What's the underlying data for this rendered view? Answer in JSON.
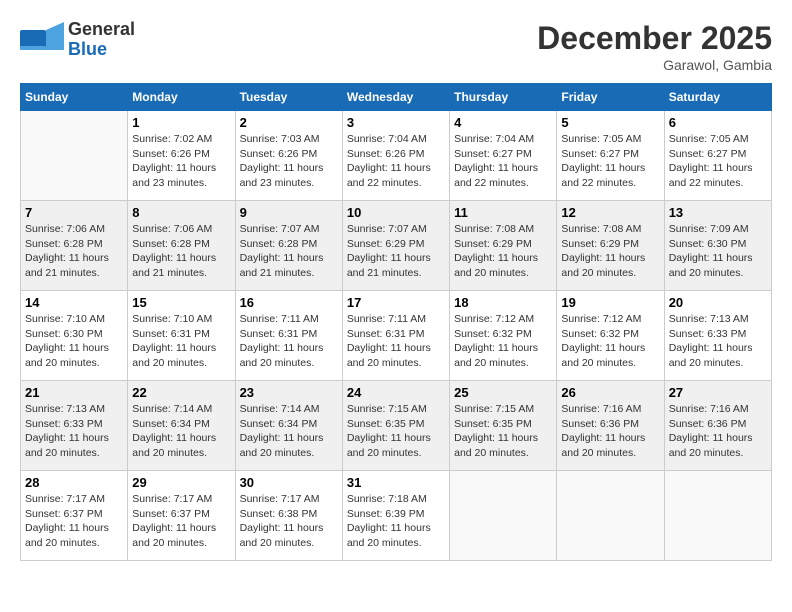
{
  "logo": {
    "line1": "General",
    "line2": "Blue"
  },
  "title": "December 2025",
  "subtitle": "Garawol, Gambia",
  "days_of_week": [
    "Sunday",
    "Monday",
    "Tuesday",
    "Wednesday",
    "Thursday",
    "Friday",
    "Saturday"
  ],
  "weeks": [
    [
      {
        "day": "",
        "info": ""
      },
      {
        "day": "1",
        "info": "Sunrise: 7:02 AM\nSunset: 6:26 PM\nDaylight: 11 hours\nand 23 minutes."
      },
      {
        "day": "2",
        "info": "Sunrise: 7:03 AM\nSunset: 6:26 PM\nDaylight: 11 hours\nand 23 minutes."
      },
      {
        "day": "3",
        "info": "Sunrise: 7:04 AM\nSunset: 6:26 PM\nDaylight: 11 hours\nand 22 minutes."
      },
      {
        "day": "4",
        "info": "Sunrise: 7:04 AM\nSunset: 6:27 PM\nDaylight: 11 hours\nand 22 minutes."
      },
      {
        "day": "5",
        "info": "Sunrise: 7:05 AM\nSunset: 6:27 PM\nDaylight: 11 hours\nand 22 minutes."
      },
      {
        "day": "6",
        "info": "Sunrise: 7:05 AM\nSunset: 6:27 PM\nDaylight: 11 hours\nand 22 minutes."
      }
    ],
    [
      {
        "day": "7",
        "info": "Sunrise: 7:06 AM\nSunset: 6:28 PM\nDaylight: 11 hours\nand 21 minutes."
      },
      {
        "day": "8",
        "info": "Sunrise: 7:06 AM\nSunset: 6:28 PM\nDaylight: 11 hours\nand 21 minutes."
      },
      {
        "day": "9",
        "info": "Sunrise: 7:07 AM\nSunset: 6:28 PM\nDaylight: 11 hours\nand 21 minutes."
      },
      {
        "day": "10",
        "info": "Sunrise: 7:07 AM\nSunset: 6:29 PM\nDaylight: 11 hours\nand 21 minutes."
      },
      {
        "day": "11",
        "info": "Sunrise: 7:08 AM\nSunset: 6:29 PM\nDaylight: 11 hours\nand 20 minutes."
      },
      {
        "day": "12",
        "info": "Sunrise: 7:08 AM\nSunset: 6:29 PM\nDaylight: 11 hours\nand 20 minutes."
      },
      {
        "day": "13",
        "info": "Sunrise: 7:09 AM\nSunset: 6:30 PM\nDaylight: 11 hours\nand 20 minutes."
      }
    ],
    [
      {
        "day": "14",
        "info": "Sunrise: 7:10 AM\nSunset: 6:30 PM\nDaylight: 11 hours\nand 20 minutes."
      },
      {
        "day": "15",
        "info": "Sunrise: 7:10 AM\nSunset: 6:31 PM\nDaylight: 11 hours\nand 20 minutes."
      },
      {
        "day": "16",
        "info": "Sunrise: 7:11 AM\nSunset: 6:31 PM\nDaylight: 11 hours\nand 20 minutes."
      },
      {
        "day": "17",
        "info": "Sunrise: 7:11 AM\nSunset: 6:31 PM\nDaylight: 11 hours\nand 20 minutes."
      },
      {
        "day": "18",
        "info": "Sunrise: 7:12 AM\nSunset: 6:32 PM\nDaylight: 11 hours\nand 20 minutes."
      },
      {
        "day": "19",
        "info": "Sunrise: 7:12 AM\nSunset: 6:32 PM\nDaylight: 11 hours\nand 20 minutes."
      },
      {
        "day": "20",
        "info": "Sunrise: 7:13 AM\nSunset: 6:33 PM\nDaylight: 11 hours\nand 20 minutes."
      }
    ],
    [
      {
        "day": "21",
        "info": "Sunrise: 7:13 AM\nSunset: 6:33 PM\nDaylight: 11 hours\nand 20 minutes."
      },
      {
        "day": "22",
        "info": "Sunrise: 7:14 AM\nSunset: 6:34 PM\nDaylight: 11 hours\nand 20 minutes."
      },
      {
        "day": "23",
        "info": "Sunrise: 7:14 AM\nSunset: 6:34 PM\nDaylight: 11 hours\nand 20 minutes."
      },
      {
        "day": "24",
        "info": "Sunrise: 7:15 AM\nSunset: 6:35 PM\nDaylight: 11 hours\nand 20 minutes."
      },
      {
        "day": "25",
        "info": "Sunrise: 7:15 AM\nSunset: 6:35 PM\nDaylight: 11 hours\nand 20 minutes."
      },
      {
        "day": "26",
        "info": "Sunrise: 7:16 AM\nSunset: 6:36 PM\nDaylight: 11 hours\nand 20 minutes."
      },
      {
        "day": "27",
        "info": "Sunrise: 7:16 AM\nSunset: 6:36 PM\nDaylight: 11 hours\nand 20 minutes."
      }
    ],
    [
      {
        "day": "28",
        "info": "Sunrise: 7:17 AM\nSunset: 6:37 PM\nDaylight: 11 hours\nand 20 minutes."
      },
      {
        "day": "29",
        "info": "Sunrise: 7:17 AM\nSunset: 6:37 PM\nDaylight: 11 hours\nand 20 minutes."
      },
      {
        "day": "30",
        "info": "Sunrise: 7:17 AM\nSunset: 6:38 PM\nDaylight: 11 hours\nand 20 minutes."
      },
      {
        "day": "31",
        "info": "Sunrise: 7:18 AM\nSunset: 6:39 PM\nDaylight: 11 hours\nand 20 minutes."
      },
      {
        "day": "",
        "info": ""
      },
      {
        "day": "",
        "info": ""
      },
      {
        "day": "",
        "info": ""
      }
    ]
  ]
}
